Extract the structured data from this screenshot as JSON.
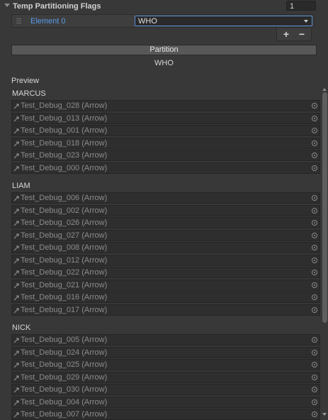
{
  "header": {
    "label": "Temp Partitioning Flags",
    "count": "1"
  },
  "list": {
    "element_label": "Element 0",
    "dropdown_value": "WHO",
    "add_label": "+",
    "remove_label": "−"
  },
  "partition_button": "Partition",
  "partition_value": "WHO",
  "preview_label": "Preview",
  "groups": [
    {
      "name": "MARCUS",
      "items": [
        "Test_Debug_028 (Arrow)",
        "Test_Debug_013 (Arrow)",
        "Test_Debug_001 (Arrow)",
        "Test_Debug_018 (Arrow)",
        "Test_Debug_023 (Arrow)",
        "Test_Debug_000 (Arrow)"
      ]
    },
    {
      "name": "LIAM",
      "items": [
        "Test_Debug_006 (Arrow)",
        "Test_Debug_002 (Arrow)",
        "Test_Debug_026 (Arrow)",
        "Test_Debug_027 (Arrow)",
        "Test_Debug_008 (Arrow)",
        "Test_Debug_012 (Arrow)",
        "Test_Debug_022 (Arrow)",
        "Test_Debug_021 (Arrow)",
        "Test_Debug_016 (Arrow)",
        "Test_Debug_017 (Arrow)"
      ]
    },
    {
      "name": "NICK",
      "items": [
        "Test_Debug_005 (Arrow)",
        "Test_Debug_024 (Arrow)",
        "Test_Debug_025 (Arrow)",
        "Test_Debug_029 (Arrow)",
        "Test_Debug_030 (Arrow)",
        "Test_Debug_004 (Arrow)",
        "Test_Debug_007 (Arrow)"
      ]
    }
  ],
  "icons": {
    "object": "arrow-object-icon",
    "picker": "object-picker-icon"
  },
  "colors": {
    "accent": "#5a9be6",
    "background": "#383838",
    "field": "#2e2e2e"
  }
}
